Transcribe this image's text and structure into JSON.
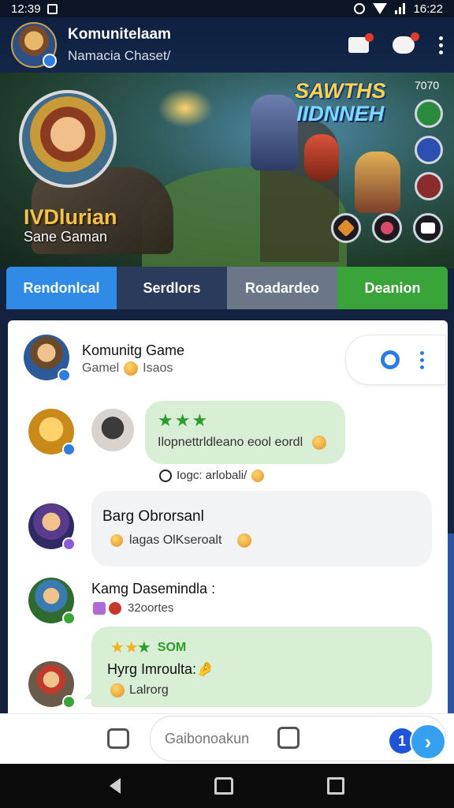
{
  "status_bar": {
    "time": "12:39",
    "right_text": "16:22"
  },
  "header": {
    "title": "Komunitelaam",
    "subtitle": "Namacia Chaset/"
  },
  "banner": {
    "hero_name": "IVDlurian",
    "hero_subtitle": "Sane Gaman",
    "logo_line1": "SAWTHS",
    "logo_line2": "IIDNNEH",
    "version": "7070"
  },
  "tabs": [
    {
      "label": "Rendonlcal",
      "color": "#2f8be6",
      "active": true
    },
    {
      "label": "Serdlors",
      "color": "#2a3b5b",
      "active": false
    },
    {
      "label": "Roadardeo",
      "color": "#6b7788",
      "active": false
    },
    {
      "label": "Deanion",
      "color": "#3aa33a",
      "active": false
    }
  ],
  "feed": {
    "group_title": "Komunitg Game",
    "group_sub_left": "Gamel",
    "group_sub_right": "Isaos",
    "message1_stars": "★★★",
    "message1_text": "Ilopnettrldleano eool eordl",
    "message1_reply_meta": "Iogc: arlobali/",
    "message2_name": "Barg Obrorsanl",
    "message2_text": "lagas OlKseroalt",
    "message3_user": "Kamg Dasemindla :",
    "message3_meta": "32oortes",
    "message4_rating_label": "SOM",
    "message4_title": "Hyrg Imroulta:",
    "message4_title_emoji": "🤌",
    "message4_text": "Lalrorg"
  },
  "composer": {
    "placeholder": "Gaibonoakun",
    "count": "1",
    "send_glyph": "›"
  },
  "colors": {
    "accent_blue": "#2f8be6",
    "accent_green": "#3aa33a",
    "header_bg": "#0f2040"
  },
  "icons": [
    "notification-icon",
    "chat-icon",
    "more-icon",
    "settings-icon",
    "kebab-icon",
    "attach-icon",
    "sticker-icon",
    "send-icon",
    "nav-back-icon",
    "nav-home-icon",
    "nav-recent-icon"
  ]
}
